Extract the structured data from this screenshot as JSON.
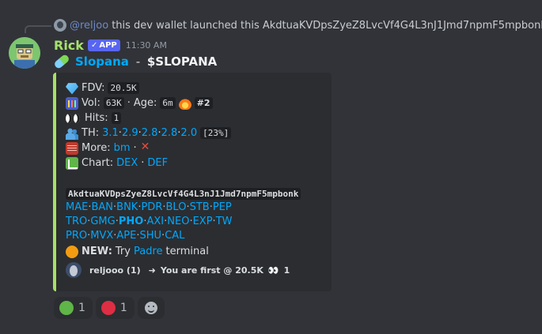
{
  "reply": {
    "user": "@reljoo",
    "text": "this dev wallet launched this AkdtuaKVDpsZyeZ8LvcVf4G4L3nJ1Jmd7npmF5mpbonk"
  },
  "message": {
    "username": "Rick",
    "badge": "APP",
    "timestamp": "11:30 AM",
    "token_name": "Slopana",
    "token_sep": " - ",
    "ticker": "$SLOPANA"
  },
  "embed": {
    "accent_color": "#a8e063",
    "fdv_label": "FDV:",
    "fdv_value": "20.5K",
    "vol_label": "Vol:",
    "vol_value": "63K",
    "age_sep": "·",
    "age_label": "Age:",
    "age_value": "6m",
    "rank": "#2",
    "hits_label": "Hits:",
    "hits_value": "1",
    "th_label": "TH:",
    "th_values": [
      "3.1",
      "2.9",
      "2.8",
      "2.8",
      "2.0"
    ],
    "th_percent": "[23%]",
    "more_label": "More:",
    "more_link": "bm",
    "more_sep": "·",
    "chart_label": "Chart:",
    "chart_links": [
      "DEX",
      "DEF"
    ],
    "chart_sep": "·",
    "address": "AkdtuaKVDpsZyeZ8LvcVf4G4L3nJ1Jmd7npmF5mpbonk",
    "ticker_rows": [
      [
        "MAE",
        "BAN",
        "BNK",
        "PDR",
        "BLO",
        "STB",
        "PEP"
      ],
      [
        "TRO",
        "GMG",
        "PHO",
        "AXI",
        "NEO",
        "EXP",
        "TW"
      ],
      [
        "PRO",
        "MVX",
        "APE",
        "SHU",
        "CAL"
      ]
    ],
    "bold_ticker": "PHO",
    "new_label": "NEW:",
    "new_try": "Try",
    "new_link": "Padre",
    "new_rest": "terminal",
    "footer_user": "reljooo (1)",
    "footer_arrow": "➜",
    "footer_text": "You are first @ 20.5K",
    "footer_eyes": "👀",
    "footer_count": "1"
  },
  "reactions": [
    {
      "color": "#5fb548",
      "count": "1"
    },
    {
      "color": "#dd2e44",
      "count": "1"
    }
  ],
  "icons": {
    "fdv": "gem-icon",
    "vol": "bar-chart-icon",
    "age": "fire-icon",
    "hits": "eyes-icon",
    "th": "people-icon",
    "more": "ledger-icon",
    "more_x": "x-icon",
    "chart": "chart-up-icon",
    "new": "orange-circle-icon",
    "add_reaction": "smile-icon"
  }
}
